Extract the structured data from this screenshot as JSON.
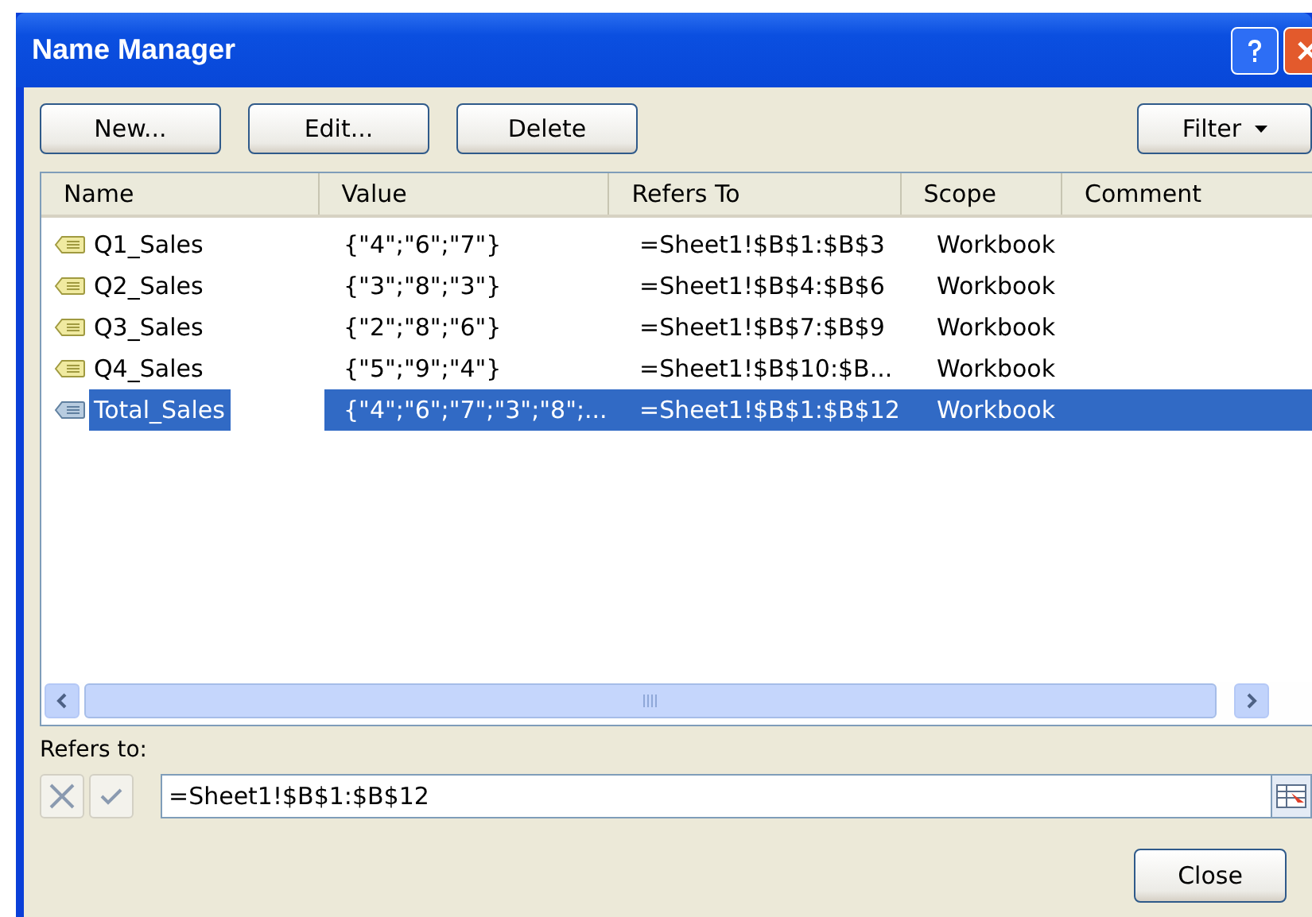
{
  "window": {
    "title": "Name Manager"
  },
  "toolbar": {
    "buttons": [
      "New...",
      "Edit...",
      "Delete"
    ],
    "filter": "Filter"
  },
  "table": {
    "columns": [
      "Name",
      "Value",
      "Refers To",
      "Scope",
      "Comment"
    ],
    "rows": [
      {
        "name": "Q1_Sales",
        "value": "{\"4\";\"6\";\"7\"}",
        "refers_to": "=Sheet1!$B$1:$B$3",
        "scope": "Workbook",
        "selected": false
      },
      {
        "name": "Q2_Sales",
        "value": "{\"3\";\"8\";\"3\"}",
        "refers_to": "=Sheet1!$B$4:$B$6",
        "scope": "Workbook",
        "selected": false
      },
      {
        "name": "Q3_Sales",
        "value": "{\"2\";\"8\";\"6\"}",
        "refers_to": "=Sheet1!$B$7:$B$9",
        "scope": "Workbook",
        "selected": false
      },
      {
        "name": "Q4_Sales",
        "value": "{\"5\";\"9\";\"4\"}",
        "refers_to": "=Sheet1!$B$10:$B...",
        "scope": "Workbook",
        "selected": false
      },
      {
        "name": "Total_Sales",
        "value": "{\"4\";\"6\";\"7\";\"3\";\"8\";...",
        "refers_to": "=Sheet1!$B$1:$B$12",
        "scope": "Workbook",
        "selected": true
      }
    ]
  },
  "refers_to": {
    "label": "Refers to:",
    "value": "=Sheet1!$B$1:$B$12"
  },
  "close_button": "Close"
}
